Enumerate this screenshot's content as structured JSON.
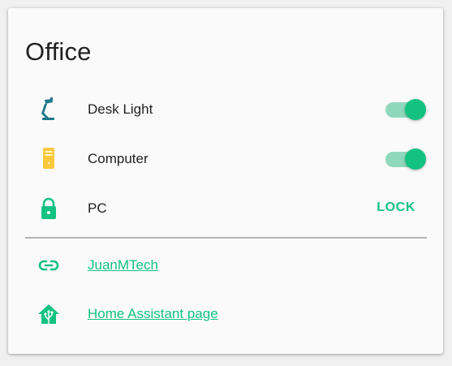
{
  "card": {
    "title": "Office",
    "entities": [
      {
        "name": "Desk Light",
        "icon": "desk-lamp-icon",
        "state": "on"
      },
      {
        "name": "Computer",
        "icon": "desktop-tower-icon",
        "state": "on"
      },
      {
        "name": "PC",
        "icon": "lock-icon",
        "action": "LOCK"
      }
    ],
    "links": [
      {
        "label": "JuanMTech",
        "icon": "link-icon"
      },
      {
        "label": "Home Assistant page",
        "icon": "home-assistant-icon"
      }
    ]
  },
  "colors": {
    "accent": "#13c281",
    "lamp": "#20788a",
    "computer": "#fcc83c",
    "toggle_track": "#8fd8bd"
  }
}
